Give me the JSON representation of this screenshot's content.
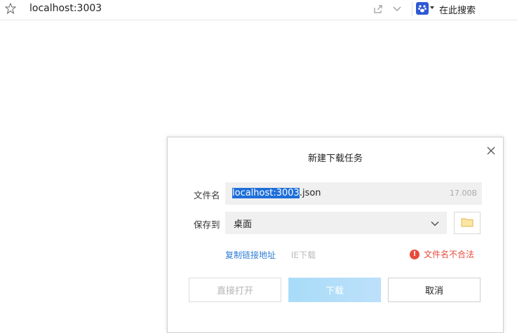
{
  "browser": {
    "url": "localhost:3003",
    "search_engine_label": "在此搜索"
  },
  "dialog": {
    "title": "新建下载任务",
    "filename_label": "文件名",
    "filename_selected": "localhost:3003",
    "filename_rest": ".json",
    "file_size": "17.00B",
    "save_to_label": "保存到",
    "save_location": "桌面",
    "copy_link_label": "复制链接地址",
    "ie_download_label": "IE下载",
    "error_message": "文件名不合法",
    "open_button": "直接打开",
    "download_button": "下载",
    "cancel_button": "取消"
  },
  "colors": {
    "link": "#2f7dd6",
    "error": "#e84b3c",
    "selection": "#1e6fd9",
    "download_button": "#a8dcf8"
  },
  "icons": [
    "star-icon",
    "share-icon",
    "chevron-down-icon",
    "paw-icon",
    "close-icon",
    "folder-icon",
    "error-icon"
  ]
}
